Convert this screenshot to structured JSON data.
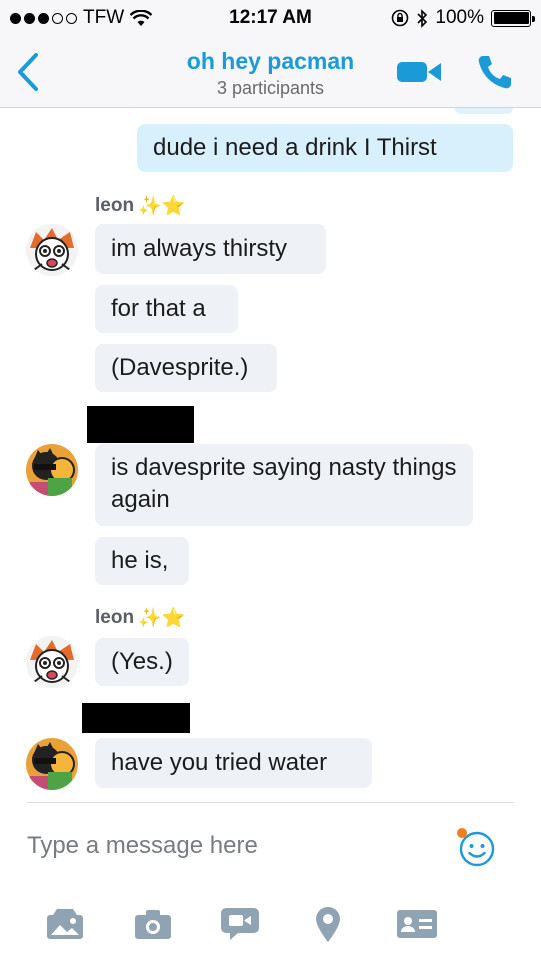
{
  "status_bar": {
    "carrier": "TFW",
    "time": "12:17 AM",
    "battery": "100%",
    "battery_level": 1.0
  },
  "header": {
    "title": "oh hey pacman",
    "subtitle": "3 participants",
    "back_icon": "chevron-left-icon",
    "video_icon": "video-camera-icon",
    "call_icon": "phone-icon"
  },
  "messages": [
    {
      "direction": "outgoing",
      "text": "dude i need a drink I Thirst"
    },
    {
      "direction": "incoming",
      "sender": "leon",
      "sender_emoji": "✨⭐",
      "text": "im always thirsty"
    },
    {
      "direction": "incoming",
      "sender": "leon",
      "text": "for that a"
    },
    {
      "direction": "incoming",
      "sender": "leon",
      "text": "(Davesprite.)"
    },
    {
      "direction": "incoming",
      "sender_redacted": true,
      "text": "is davesprite saying nasty things again"
    },
    {
      "direction": "incoming",
      "sender_redacted": true,
      "text": "he is,"
    },
    {
      "direction": "incoming",
      "sender": "leon",
      "sender_emoji": "✨⭐",
      "text": "(Yes.)"
    },
    {
      "direction": "incoming",
      "sender_redacted": true,
      "text": "have you tried water"
    }
  ],
  "composer": {
    "placeholder": "Type a message here",
    "emoji_icon": "smiley-icon"
  },
  "toolbar": [
    "media-gallery-icon",
    "camera-icon",
    "video-message-icon",
    "location-pin-icon",
    "contact-card-icon"
  ],
  "colors": {
    "accent": "#1b9ad8",
    "outgoing_bubble": "#d8f0fb",
    "incoming_bubble": "#eef1f5",
    "icon_gray": "#8fa3b3"
  }
}
